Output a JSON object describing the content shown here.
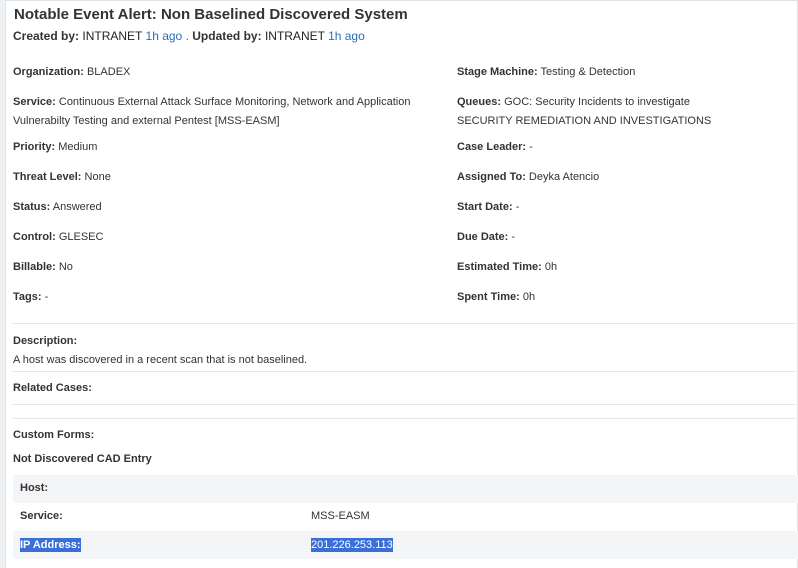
{
  "header": {
    "title": "Notable Event Alert: Non Baselined Discovered System",
    "created_label": "Created by:",
    "created_by": "INTRANET",
    "created_ago": "1h ago",
    "separator": ".",
    "updated_label": "Updated by:",
    "updated_by": "INTRANET",
    "updated_ago": "1h ago"
  },
  "fields_left": [
    {
      "label": "Organization:",
      "value": "BLADEX"
    },
    {
      "label": "Service:",
      "value": "Continuous External Attack Surface Monitoring, Network and Application",
      "value2": "Vulnerabilty Testing and external Pentest [MSS-EASM]"
    },
    {
      "label": "Priority:",
      "value": "Medium"
    },
    {
      "label": "Threat Level:",
      "value": "None"
    },
    {
      "label": "Status:",
      "value": "Answered"
    },
    {
      "label": "Control:",
      "value": "GLESEC"
    },
    {
      "label": "Billable:",
      "value": "No"
    },
    {
      "label": "Tags:",
      "value": "-"
    }
  ],
  "fields_right": [
    {
      "label": "Stage Machine:",
      "value": "Testing & Detection"
    },
    {
      "label": "Queues:",
      "value": "GOC: Security Incidents to investigate",
      "value2": "SECURITY REMEDIATION AND INVESTIGATIONS"
    },
    {
      "label": "Case Leader:",
      "value": "-"
    },
    {
      "label": "Assigned To:",
      "value": "Deyka Atencio"
    },
    {
      "label": "Start Date:",
      "value": "-"
    },
    {
      "label": "Due Date:",
      "value": "-"
    },
    {
      "label": "Estimated Time:",
      "value": "0h"
    },
    {
      "label": "Spent Time:",
      "value": "0h"
    }
  ],
  "description": {
    "label": "Description:",
    "text": "A host was discovered in a recent scan that is not baselined."
  },
  "related_cases": {
    "label": "Related Cases:"
  },
  "custom_forms": {
    "label": "Custom Forms:",
    "form_title": "Not Discovered CAD Entry",
    "rows": [
      {
        "key": "Host:",
        "value": ""
      },
      {
        "key": "Service:",
        "value": "MSS-EASM"
      },
      {
        "key": "IP Address:",
        "value": "201.226.253.113"
      }
    ]
  },
  "colors": {
    "link": "#2a6fb5",
    "selection": "#3a6fd8",
    "row_shade": "#f4f5f7"
  }
}
